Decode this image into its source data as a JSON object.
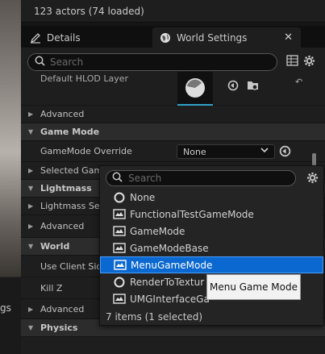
{
  "viewport": {
    "cut_label": "gs"
  },
  "outliner": {
    "status": "123 actors (74 loaded)"
  },
  "tabs": [
    {
      "label": "Details",
      "icon": "pencil-icon"
    },
    {
      "label": "World Settings",
      "icon": "globe-icon",
      "active": true
    }
  ],
  "details": {
    "search_placeholder": "Search",
    "rows": [
      {
        "label": "Default HLOD Layer"
      },
      {
        "label": "Advanced"
      },
      {
        "label": "Game Mode"
      },
      {
        "label": "GameMode Override",
        "value": "None"
      },
      {
        "label": "Selected Game"
      },
      {
        "label": "Lightmass"
      },
      {
        "label": "Lightmass Set"
      },
      {
        "label": "Advanced"
      },
      {
        "label": "World"
      },
      {
        "label": "Use Client Side"
      },
      {
        "label": "Kill Z"
      },
      {
        "label": "Advanced"
      },
      {
        "label": "Physics"
      }
    ]
  },
  "dropdown": {
    "search_placeholder": "Search",
    "items": [
      {
        "label": "None",
        "icon": "circle-icon"
      },
      {
        "label": "FunctionalTestGameMode",
        "icon": "blueprint-icon"
      },
      {
        "label": "GameMode",
        "icon": "blueprint-icon"
      },
      {
        "label": "GameModeBase",
        "icon": "blueprint-icon"
      },
      {
        "label": "MenuGameMode",
        "icon": "blueprint-icon",
        "selected": true
      },
      {
        "label": "RenderToTextur",
        "icon": "circle-icon"
      },
      {
        "label": "UMGInterfaceGa",
        "icon": "blueprint-icon"
      }
    ],
    "footer": "7 items (1 selected)",
    "tooltip": "Menu Game Mode"
  },
  "colors": {
    "selection": "#0a68d0",
    "accent": "#2fa0c8"
  }
}
